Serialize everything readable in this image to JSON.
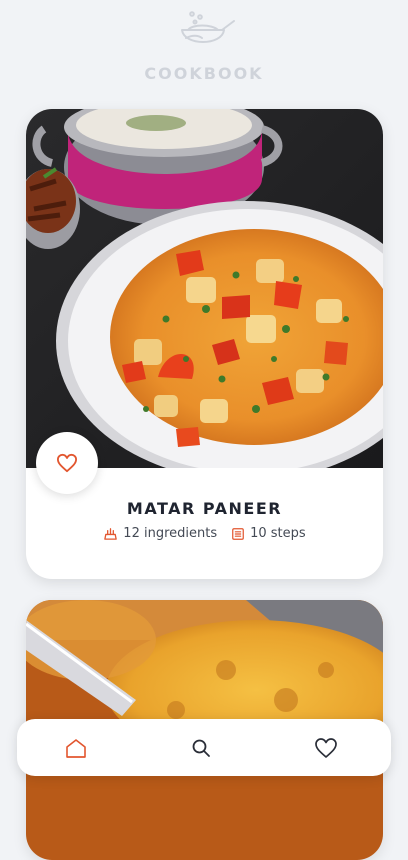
{
  "app": {
    "name": "COOKBOOK"
  },
  "recipes": [
    {
      "title": "MATAR PANEER",
      "ingredients": "12 ingredients",
      "steps": "10 steps"
    }
  ],
  "nav": {
    "items": [
      "home",
      "search",
      "favorites"
    ],
    "active": "home"
  },
  "colors": {
    "background": "#f1f3f6",
    "accent": "#e2562f",
    "logo": "#cfd3da",
    "title": "#1f2430"
  },
  "icons": [
    "cooking-pot-icon",
    "heart-icon",
    "ingredients-icon",
    "steps-icon",
    "home-icon",
    "search-icon",
    "heart-outline-icon"
  ]
}
